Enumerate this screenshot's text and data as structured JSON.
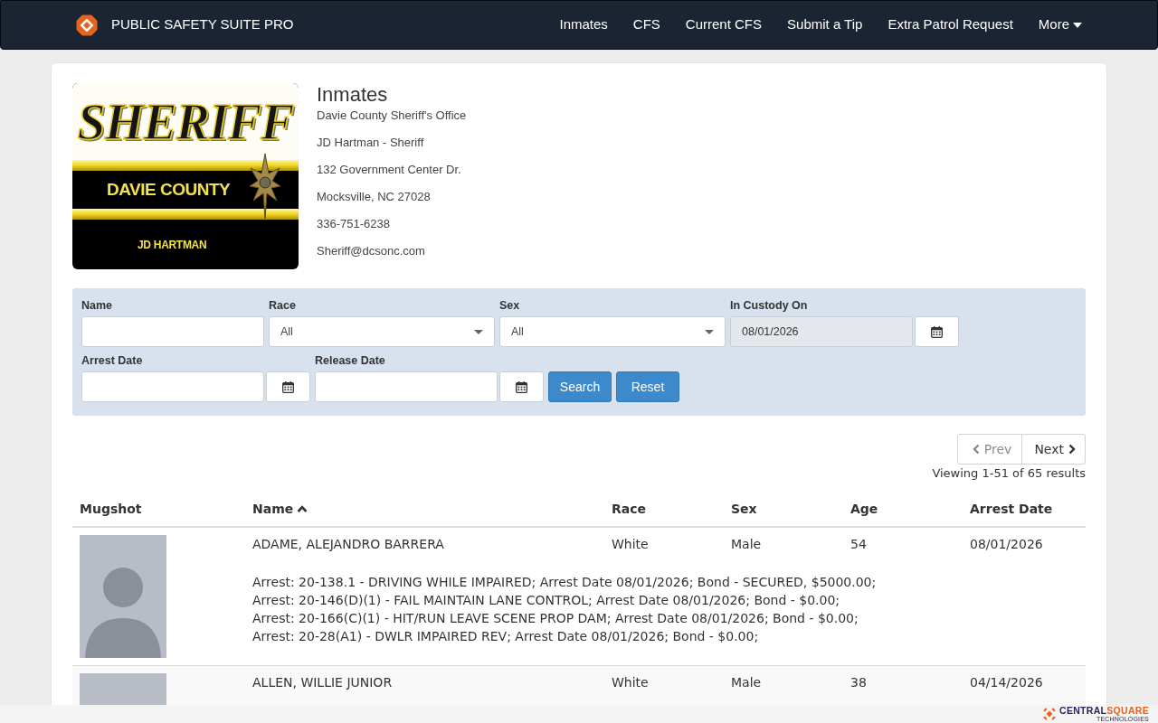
{
  "navbar": {
    "brand": "PUBLIC SAFETY SUITE PRO",
    "links": [
      {
        "label": "Inmates",
        "kind": "link"
      },
      {
        "label": "CFS",
        "kind": "link"
      },
      {
        "label": "Current CFS",
        "kind": "link"
      },
      {
        "label": "Submit a Tip",
        "kind": "link"
      },
      {
        "label": "Extra Patrol Request",
        "kind": "link"
      },
      {
        "label": "More",
        "kind": "dropdown"
      }
    ]
  },
  "agency": {
    "logo": {
      "title": "SHERIFF",
      "county": "DAVIE COUNTY",
      "sheriff": "JD HARTMAN"
    },
    "heading": "Inmates",
    "lines": [
      "Davie County Sheriff's Office",
      "JD Hartman - Sheriff",
      "132 Government Center Dr.",
      "Mocksville, NC 27028",
      "336-751-6238",
      "Sheriff@dcsonc.com"
    ]
  },
  "filters": {
    "rows": [
      [
        {
          "kind": "text",
          "label": "Name"
        },
        {
          "kind": "select",
          "label": "Race",
          "value": "All"
        },
        {
          "kind": "select",
          "label": "Sex",
          "value": "All"
        },
        {
          "kind": "date",
          "label": "In Custody On",
          "value": "08/01/2026",
          "readonly": true
        }
      ],
      [
        {
          "kind": "date",
          "label": "Arrest Date",
          "readonly": false
        },
        {
          "kind": "date",
          "label": "Release Date",
          "readonly": false
        },
        {
          "kind": "button",
          "label": "Search"
        },
        {
          "kind": "button",
          "label": "Reset"
        }
      ]
    ]
  },
  "pagination": {
    "buttons": [
      {
        "kind": "prev",
        "label": "Prev",
        "disabled": true
      },
      {
        "kind": "next",
        "label": "Next",
        "disabled": false
      }
    ],
    "summary": "Viewing 1-51 of 65 results"
  },
  "table": {
    "columns": [
      {
        "label": "Mugshot",
        "sorted": false
      },
      {
        "label": "Name",
        "sorted": true
      },
      {
        "label": "Race",
        "sorted": false
      },
      {
        "label": "Sex",
        "sorted": false
      },
      {
        "label": "Age",
        "sorted": false
      },
      {
        "label": "Arrest Date",
        "sorted": false
      }
    ],
    "rows": [
      {
        "name": "ADAME, ALEJANDRO BARRERA",
        "race": "White",
        "sex": "Male",
        "age": "54",
        "arrest_date": "08/01/2026",
        "arrests": [
          "Arrest: 20-138.1 - DRIVING WHILE IMPAIRED; Arrest Date 08/01/2026; Bond - SECURED, $5000.00;",
          "Arrest: 20-146(D)(1) - FAIL MAINTAIN LANE CONTROL; Arrest Date 08/01/2026; Bond - $0.00;",
          "Arrest: 20-166(C)(1) - HIT/RUN LEAVE SCENE PROP DAM; Arrest Date 08/01/2026; Bond - $0.00;",
          "Arrest: 20-28(A1) - DWLR IMPAIRED REV; Arrest Date 08/01/2026; Bond - $0.00;"
        ]
      },
      {
        "name": "ALLEN, WILLIE JUNIOR",
        "race": "White",
        "sex": "Male",
        "age": "38",
        "arrest_date": "04/14/2026"
      }
    ]
  },
  "footer": {
    "logo": {
      "part_1": "CENTRAL",
      "part_2": "SQUARE",
      "tagline": "TECHNOLOGIES"
    }
  }
}
